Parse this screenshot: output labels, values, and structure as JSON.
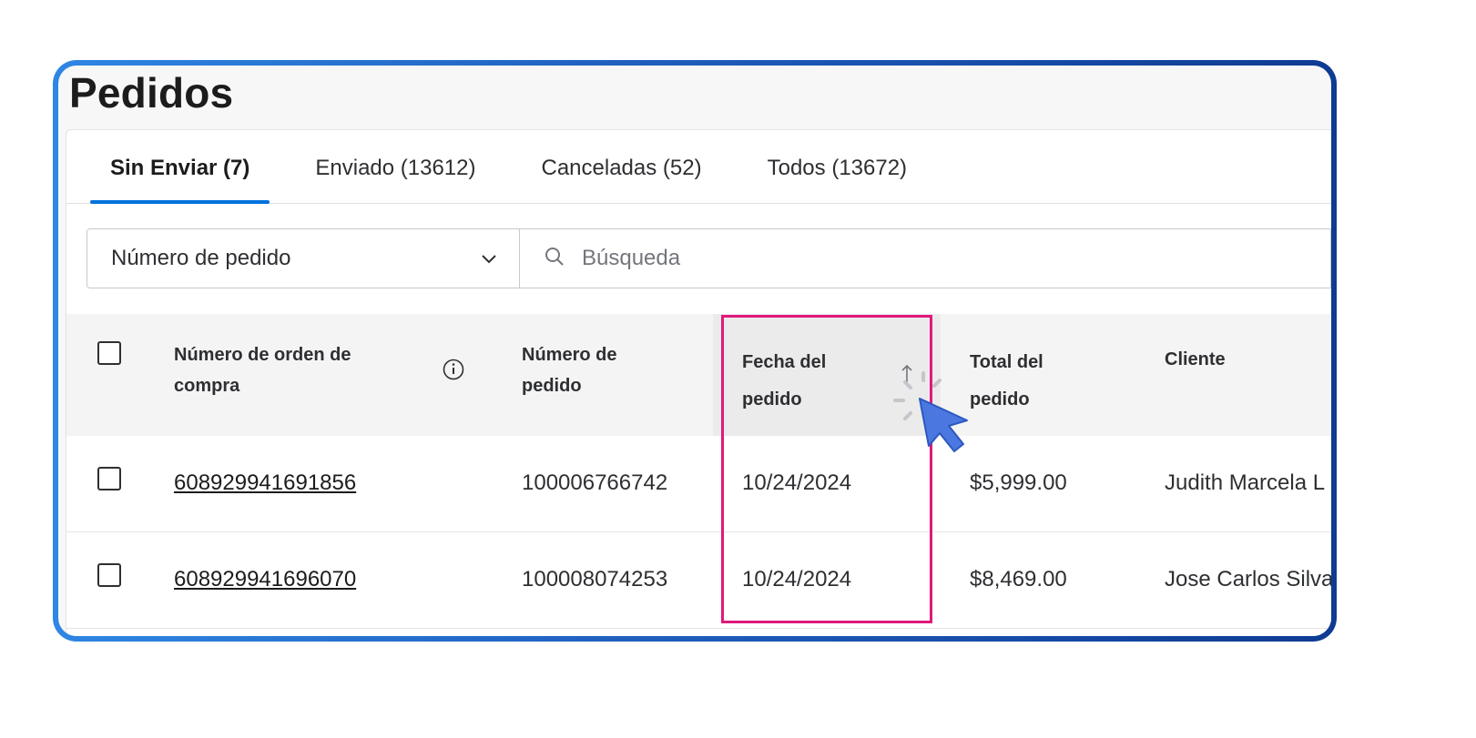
{
  "page": {
    "title": "Pedidos"
  },
  "tabs": [
    {
      "label": "Sin Enviar (7)",
      "active": true
    },
    {
      "label": "Enviado (13612)",
      "active": false
    },
    {
      "label": "Canceladas (52)",
      "active": false
    },
    {
      "label": "Todos (13672)",
      "active": false
    }
  ],
  "filter": {
    "selected": "Número de pedido",
    "search_placeholder": "Búsqueda"
  },
  "table": {
    "columns": [
      "Número de orden de compra",
      "Número de pedido",
      "Fecha del pedido",
      "Total del pedido",
      "Cliente"
    ],
    "sorted_column": "Fecha del pedido",
    "rows": [
      {
        "po_number": "608929941691856",
        "order_number": "100006766742",
        "date": "10/24/2024",
        "total": "$5,999.00",
        "customer": "Judith Marcela L"
      },
      {
        "po_number": "608929941696070",
        "order_number": "100008074253",
        "date": "10/24/2024",
        "total": "$8,469.00",
        "customer": "Jose Carlos Silva"
      }
    ]
  },
  "colors": {
    "accent": "#0071dc",
    "highlight": "#e0197d",
    "frame_start": "#2f86e3",
    "frame_end": "#0e3b93",
    "cursor": "#4a78e0"
  },
  "icons": {
    "info": "info-icon",
    "sort": "arrow-up-icon",
    "chevron": "chevron-down-icon",
    "search": "search-icon",
    "cursor": "pointer-cursor-icon"
  }
}
